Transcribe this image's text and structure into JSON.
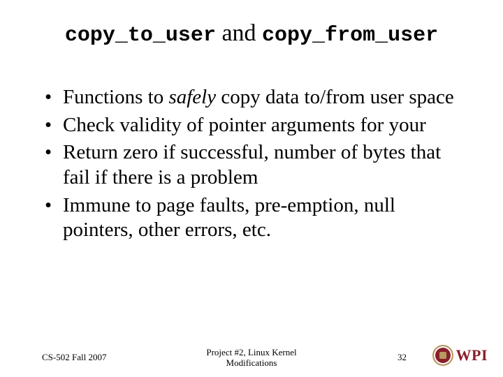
{
  "title": {
    "code1": "copy_to_user",
    "connector": " and ",
    "code2": "copy_from_user"
  },
  "bullets": [
    {
      "pre": "Functions to ",
      "em": "safely",
      "post": " copy data to/from user space"
    },
    {
      "pre": "Check validity of pointer arguments for your",
      "em": "",
      "post": ""
    },
    {
      "pre": "Return zero if successful, number of bytes that fail if there is a problem",
      "em": "",
      "post": ""
    },
    {
      "pre": "Immune to page faults, pre-emption, null pointers, other errors, etc.",
      "em": "",
      "post": ""
    }
  ],
  "footer": {
    "left": "CS-502 Fall 2007",
    "center_line1": "Project #2, Linux Kernel",
    "center_line2": "Modifications",
    "page": "32",
    "logo_text": "WPI"
  }
}
